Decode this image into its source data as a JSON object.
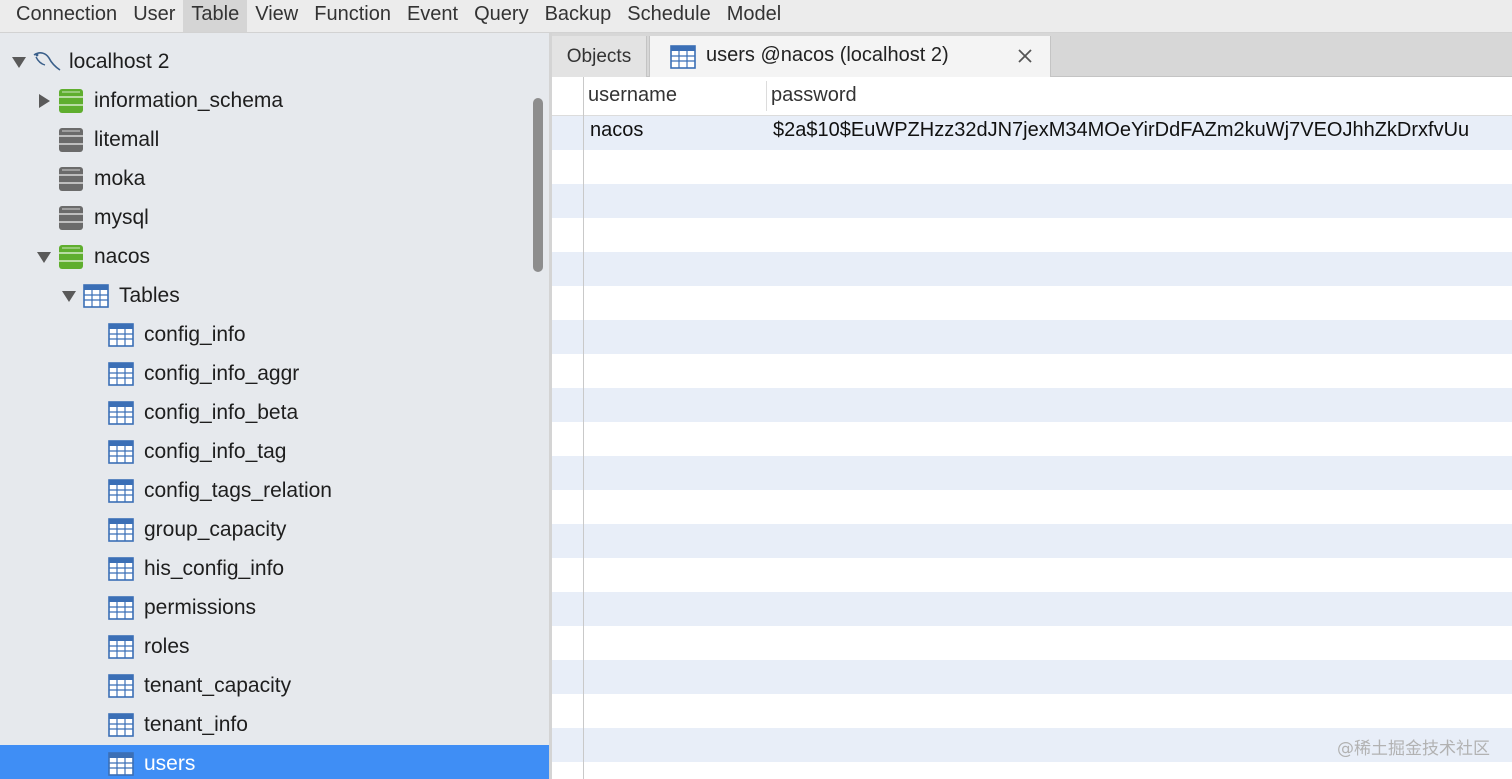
{
  "menu": {
    "items": [
      "Connection",
      "User",
      "Table",
      "View",
      "Function",
      "Event",
      "Query",
      "Backup",
      "Schedule",
      "Model"
    ],
    "active": "Table"
  },
  "sidebar": {
    "connection": "localhost 2",
    "databases": [
      {
        "name": "information_schema",
        "open": true,
        "expanded": false
      },
      {
        "name": "litemall",
        "open": false,
        "expanded": false
      },
      {
        "name": "moka",
        "open": false,
        "expanded": false
      },
      {
        "name": "mysql",
        "open": false,
        "expanded": false
      },
      {
        "name": "nacos",
        "open": true,
        "expanded": true
      }
    ],
    "tables_folder": "Tables",
    "tables": [
      "config_info",
      "config_info_aggr",
      "config_info_beta",
      "config_info_tag",
      "config_tags_relation",
      "group_capacity",
      "his_config_info",
      "permissions",
      "roles",
      "tenant_capacity",
      "tenant_info",
      "users"
    ],
    "selected_table": "users"
  },
  "tabs": {
    "objects_label": "Objects",
    "active_label": "users @nacos (localhost 2)"
  },
  "grid": {
    "columns": [
      "username",
      "password"
    ],
    "rows": [
      [
        "nacos",
        "$2a$10$EuWPZHzz32dJN7jexM34MOeYirDdFAZm2kuWj7VEOJhhZkDrxfvUu"
      ]
    ]
  },
  "watermark": "@稀土掘金技术社区",
  "colors": {
    "selection": "#3f8ef5",
    "db_open": "#5fae2e",
    "db_closed": "#6b6b6b",
    "table_icon": "#3b6fb6",
    "alt_row": "#e8eef8"
  }
}
